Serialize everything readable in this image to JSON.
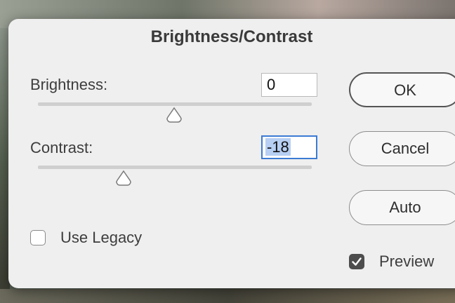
{
  "dialog": {
    "title": "Brightness/Contrast"
  },
  "brightness": {
    "label": "Brightness:",
    "value": "0",
    "slider_fraction": 0.5
  },
  "contrast": {
    "label": "Contrast:",
    "value": "-18",
    "slider_fraction": 0.31
  },
  "legacy": {
    "label": "Use Legacy",
    "checked": false
  },
  "buttons": {
    "ok": "OK",
    "cancel": "Cancel",
    "auto": "Auto"
  },
  "preview": {
    "label": "Preview",
    "checked": true
  },
  "colors": {
    "focus_ring": "#3b7bd4",
    "text_selection": "#b6cff3",
    "checkbox_checked": "#4d4d4d"
  },
  "icons": {
    "slider_thumb": "triangle-thumb-icon",
    "checkmark": "checkmark-icon"
  }
}
